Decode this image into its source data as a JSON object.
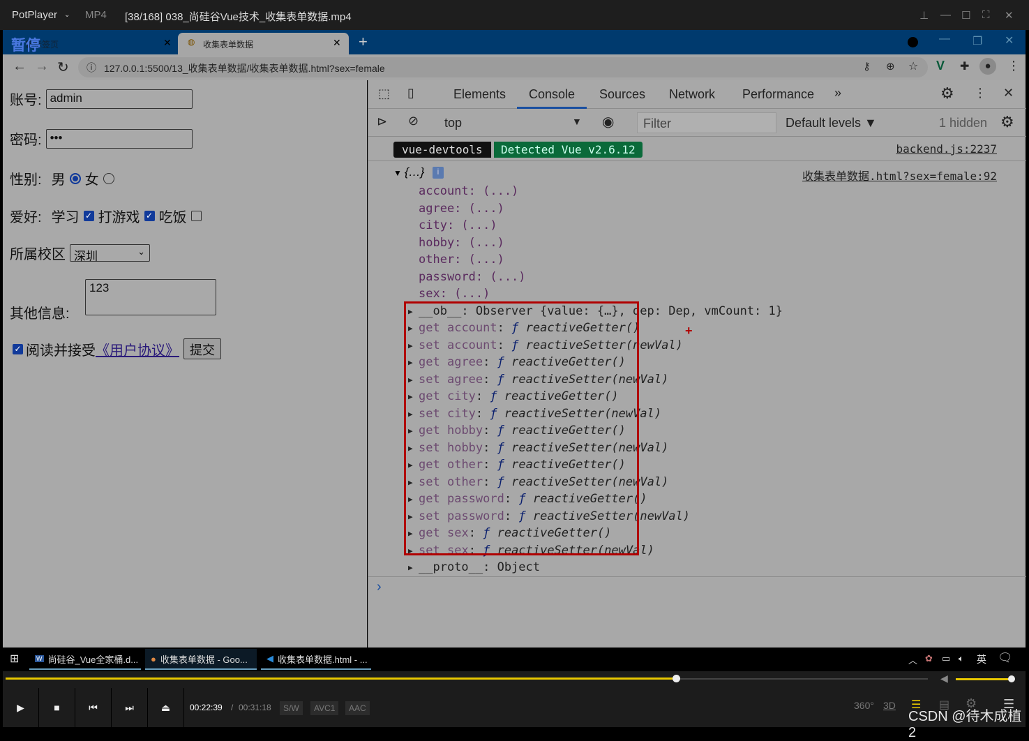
{
  "player": {
    "app": "PotPlayer",
    "format": "MP4",
    "title": "[38/168] 038_尚硅谷Vue技术_收集表单数据.mp4",
    "pause_overlay": "暂停",
    "time_current": "00:22:39",
    "time_total": "00:31:18",
    "badges": [
      "S/W",
      "AVC1",
      "AAC"
    ],
    "progress": 0.727,
    "volume": 1.0,
    "right_icons": [
      "360°",
      "3D"
    ],
    "watermark": "CSDN @待木成植2"
  },
  "browser": {
    "tabs": [
      {
        "label": "新标签页"
      },
      {
        "label": "收集表单数据"
      }
    ],
    "url": "127.0.0.1:5500/13_收集表单数据/收集表单数据.html?sex=female"
  },
  "form": {
    "account_label": "账号:",
    "account_value": "admin",
    "password_label": "密码:",
    "password_value": "•••",
    "sex_label": "性别:",
    "male": "男",
    "female": "女",
    "hobby_label": "爱好:",
    "hobbies": [
      "学习",
      "打游戏",
      "吃饭"
    ],
    "city_label": "所属校区",
    "city_value": "深圳",
    "other_label": "其他信息:",
    "other_value": "123",
    "agree_text": "阅读并接受",
    "agree_link": "《用户协议》",
    "submit": "提交"
  },
  "devtools": {
    "tabs": [
      "Elements",
      "Console",
      "Sources",
      "Network",
      "Performance"
    ],
    "active_tab": "Console",
    "context": "top",
    "filter_placeholder": "Filter",
    "levels": "Default levels ▼",
    "hidden": "1 hidden",
    "vue_badge_left": "vue-devtools",
    "vue_badge_right": "Detected Vue v2.6.12",
    "src1": "backend.js:2237",
    "src2": "收集表单数据.html?sex=female:92",
    "obj": "{…}",
    "props": [
      "account: (...)",
      "agree: (...)",
      "city: (...)",
      "hobby: (...)",
      "other: (...)",
      "password: (...)",
      "sex: (...)"
    ],
    "ob": "__ob__: Observer {value: {…}, dep: Dep, vmCount: 1}",
    "accessors": [
      [
        "get",
        "account",
        "reactiveGetter()"
      ],
      [
        "set",
        "account",
        "reactiveSetter(newVal)"
      ],
      [
        "get",
        "agree",
        "reactiveGetter()"
      ],
      [
        "set",
        "agree",
        "reactiveSetter(newVal)"
      ],
      [
        "get",
        "city",
        "reactiveGetter()"
      ],
      [
        "set",
        "city",
        "reactiveSetter(newVal)"
      ],
      [
        "get",
        "hobby",
        "reactiveGetter()"
      ],
      [
        "set",
        "hobby",
        "reactiveSetter(newVal)"
      ],
      [
        "get",
        "other",
        "reactiveGetter()"
      ],
      [
        "set",
        "other",
        "reactiveSetter(newVal)"
      ],
      [
        "get",
        "password",
        "reactiveGetter()"
      ],
      [
        "set",
        "password",
        "reactiveSetter(newVal)"
      ],
      [
        "get",
        "sex",
        "reactiveGetter()"
      ],
      [
        "set",
        "sex",
        "reactiveSetter(newVal)"
      ]
    ],
    "proto": "__proto__: Object",
    "prompt": "›"
  },
  "taskbar": {
    "items": [
      "尚硅谷_Vue全家桶.d...",
      "收集表单数据 - Goo...",
      "收集表单数据.html - ..."
    ],
    "ime": "英"
  },
  "colors": {
    "highlight_box": "#b00000",
    "vue_green": "#0a6a3a",
    "tab_blue": "#003a6e",
    "progress": "#e8c800"
  }
}
